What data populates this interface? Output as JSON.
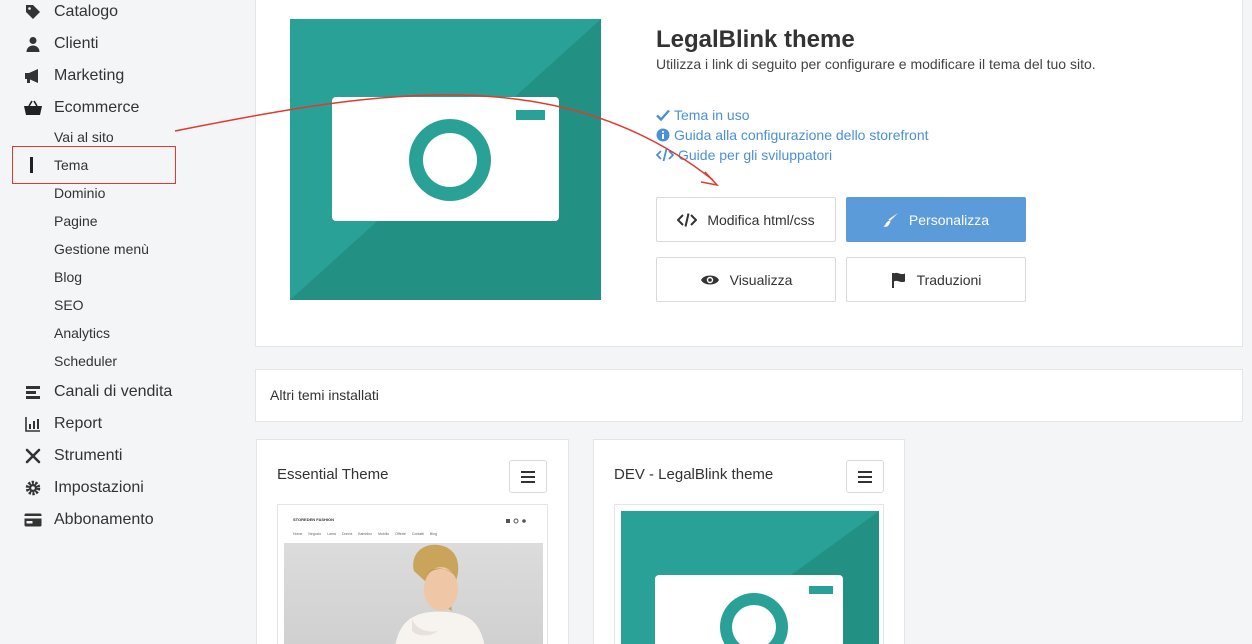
{
  "sidebar": {
    "items": [
      {
        "label": "Catalogo",
        "icon": "tag-icon"
      },
      {
        "label": "Clienti",
        "icon": "user-icon"
      },
      {
        "label": "Marketing",
        "icon": "megaphone-icon"
      },
      {
        "label": "Ecommerce",
        "icon": "basket-icon"
      },
      {
        "label": "Canali di vendita",
        "icon": "layers-icon"
      },
      {
        "label": "Report",
        "icon": "bar-chart-icon"
      },
      {
        "label": "Strumenti",
        "icon": "tools-icon"
      },
      {
        "label": "Impostazioni",
        "icon": "gear-icon"
      },
      {
        "label": "Abbonamento",
        "icon": "credit-card-icon"
      }
    ],
    "subitems": [
      "Vai al sito",
      "Tema",
      "Dominio",
      "Pagine",
      "Gestione menù",
      "Blog",
      "SEO",
      "Analytics",
      "Scheduler"
    ]
  },
  "theme": {
    "title": "LegalBlink theme",
    "description": "Utilizza i link di seguito per configurare e modificare il tema del tuo sito.",
    "links": [
      "Tema in uso",
      "Guida alla configurazione dello storefront",
      "Guide per gli sviluppatori"
    ],
    "buttons": {
      "edit": "Modifica html/css",
      "customize": "Personalizza",
      "view": "Visualizza",
      "translations": "Traduzioni"
    }
  },
  "installed": {
    "heading": "Altri temi installati",
    "cards": [
      {
        "title": "Essential Theme",
        "store_name": "STOREDEN FASHION",
        "menu": [
          "Home",
          "Negozio",
          "Lama",
          "Donna",
          "Bambino",
          "Mobilio",
          "Offerte",
          "Contatti",
          "Blog"
        ]
      },
      {
        "title": "DEV - LegalBlink theme"
      }
    ]
  },
  "colors": {
    "accent": "#5b9bd9",
    "teal": "#2aa196",
    "annotation": "#e03a2f"
  }
}
